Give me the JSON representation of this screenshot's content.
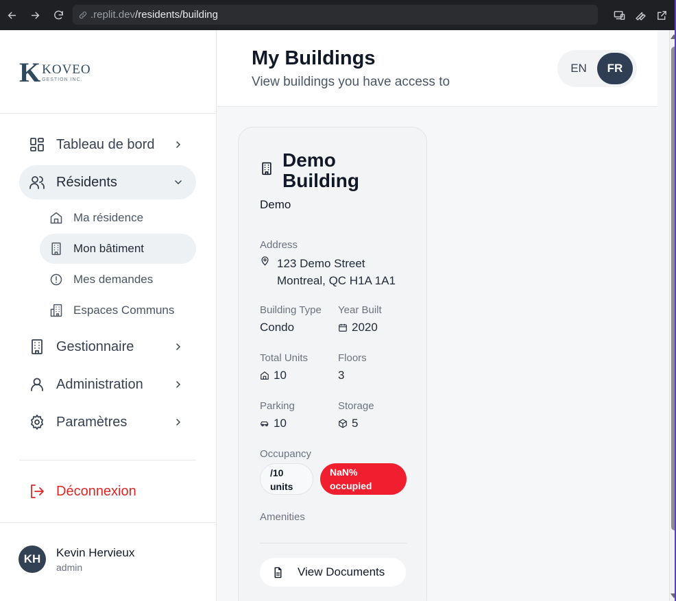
{
  "browser": {
    "url_prefix": ".replit.dev",
    "url_path": "/residents/building"
  },
  "logo": {
    "letter": "K",
    "name": "KOVEO",
    "tagline": "GESTION INC."
  },
  "sidebar": {
    "items": [
      {
        "label": "Tableau de bord",
        "icon": "layout-grid-icon"
      },
      {
        "label": "Résidents",
        "icon": "users-icon",
        "expanded": true
      },
      {
        "label": "Gestionnaire",
        "icon": "building-icon"
      },
      {
        "label": "Administration",
        "icon": "user-icon"
      },
      {
        "label": "Paramètres",
        "icon": "gear-icon"
      }
    ],
    "sub_items": [
      {
        "label": "Ma résidence",
        "icon": "home-icon"
      },
      {
        "label": "Mon bâtiment",
        "icon": "building-icon",
        "active": true
      },
      {
        "label": "Mes demandes",
        "icon": "alert-circle-icon"
      },
      {
        "label": "Espaces Communs",
        "icon": "buildings-icon"
      }
    ],
    "logout": "Déconnexion"
  },
  "user": {
    "initials": "KH",
    "name": "Kevin Hervieux",
    "role": "admin"
  },
  "header": {
    "title": "My Buildings",
    "subtitle": "View buildings you have access to",
    "lang_en": "EN",
    "lang_fr": "FR",
    "lang_selected": "FR"
  },
  "building": {
    "name": "Demo Building",
    "org": "Demo",
    "address_label": "Address",
    "address_line1": "123 Demo Street",
    "address_line2": "Montreal, QC H1A 1A1",
    "type_label": "Building Type",
    "type": "Condo",
    "year_label": "Year Built",
    "year": "2020",
    "units_label": "Total Units",
    "units": "10",
    "floors_label": "Floors",
    "floors": "3",
    "parking_label": "Parking",
    "parking": "10",
    "storage_label": "Storage",
    "storage": "5",
    "occupancy_label": "Occupancy",
    "occupancy_units_line1": "/10",
    "occupancy_units_line2": "units",
    "occupancy_pct_line1": "NaN%",
    "occupancy_pct_line2": "occupied",
    "amenities_label": "Amenities",
    "docs_button": "View Documents"
  },
  "colors": {
    "accent_dark": "#2f3e52",
    "danger": "#dc2626",
    "badge_red": "#ef1f2f"
  }
}
